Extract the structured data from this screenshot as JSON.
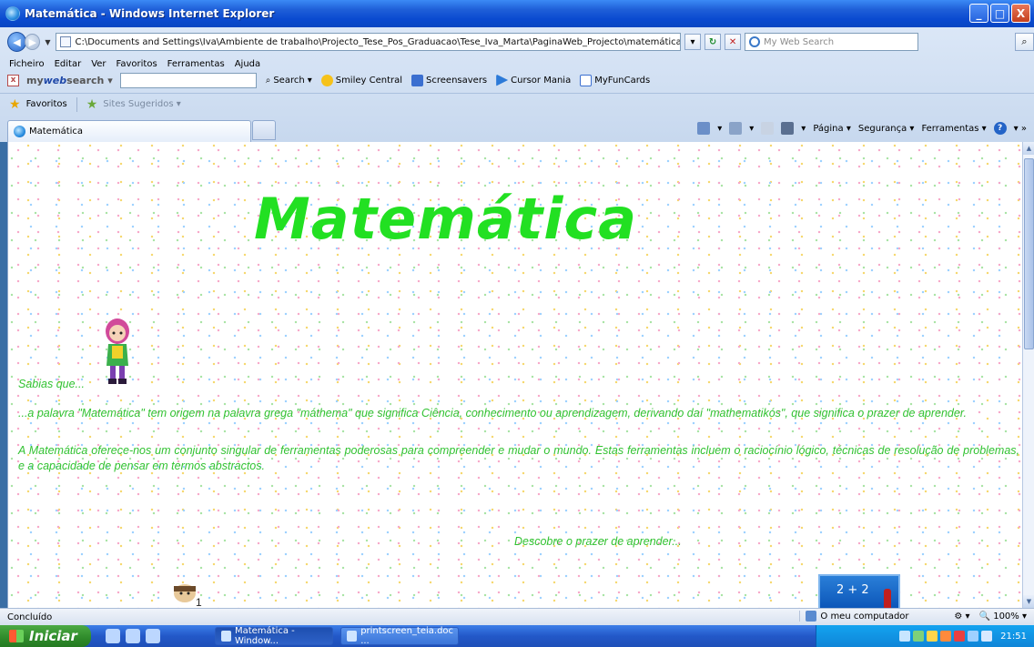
{
  "window": {
    "title": "Matemática - Windows Internet Explorer",
    "buttons": {
      "minimize": "_",
      "maximize": "□",
      "close": "X"
    }
  },
  "address_bar": {
    "url": "C:\\Documents and Settings\\Iva\\Ambiente de trabalho\\Projecto_Tese_Pos_Graduacao\\Tese_Iva_Marta\\PaginaWeb_Projecto\\matemática.htm",
    "search_placeholder": "My Web Search"
  },
  "menu": [
    "Ficheiro",
    "Editar",
    "Ver",
    "Favoritos",
    "Ferramentas",
    "Ajuda"
  ],
  "toolbar": {
    "brand_prefix": "my",
    "brand_mid": "web",
    "brand_suffix": "search",
    "search_label": "Search",
    "items": [
      "Smiley Central",
      "Screensavers",
      "Cursor Mania",
      "MyFunCards"
    ]
  },
  "favorites_bar": {
    "favorites_label": "Favoritos",
    "suggested_label": "Sites Sugeridos"
  },
  "tab": {
    "label": "Matemática"
  },
  "command_bar": {
    "page": "Página",
    "security": "Segurança",
    "tools": "Ferramentas"
  },
  "page": {
    "title": "Matemática",
    "intro": "Sabias que...",
    "paragraph1": "...a palavra \"Matemática\" tem origem na palavra grega \"máthema\" que significa Ciência, conhecimento ou aprendizagem, derivando daí \"mathematikós\", que significa o prazer de aprender.",
    "paragraph2": "A Matemática oferece-nos um conjunto singular de ferramentas poderosas para compreender e mudar o mundo. Estas ferramentas incluem o raciocínio lógico, técnicas de resolução de problemas, e a capacidade de pensar em termos abstractos.",
    "closing": "Descobre o prazer de aprender...",
    "widget_text": "2 + 2"
  },
  "status_bar": {
    "status": "Concluído",
    "zone": "O meu computador",
    "zoom": "100%"
  },
  "taskbar": {
    "start": "Iniciar",
    "tasks": [
      "Matemática - Window...",
      "printscreen_teia.doc ..."
    ],
    "clock": "21:51"
  },
  "colors": {
    "page_text": "#31c231",
    "title": "#22e022"
  }
}
